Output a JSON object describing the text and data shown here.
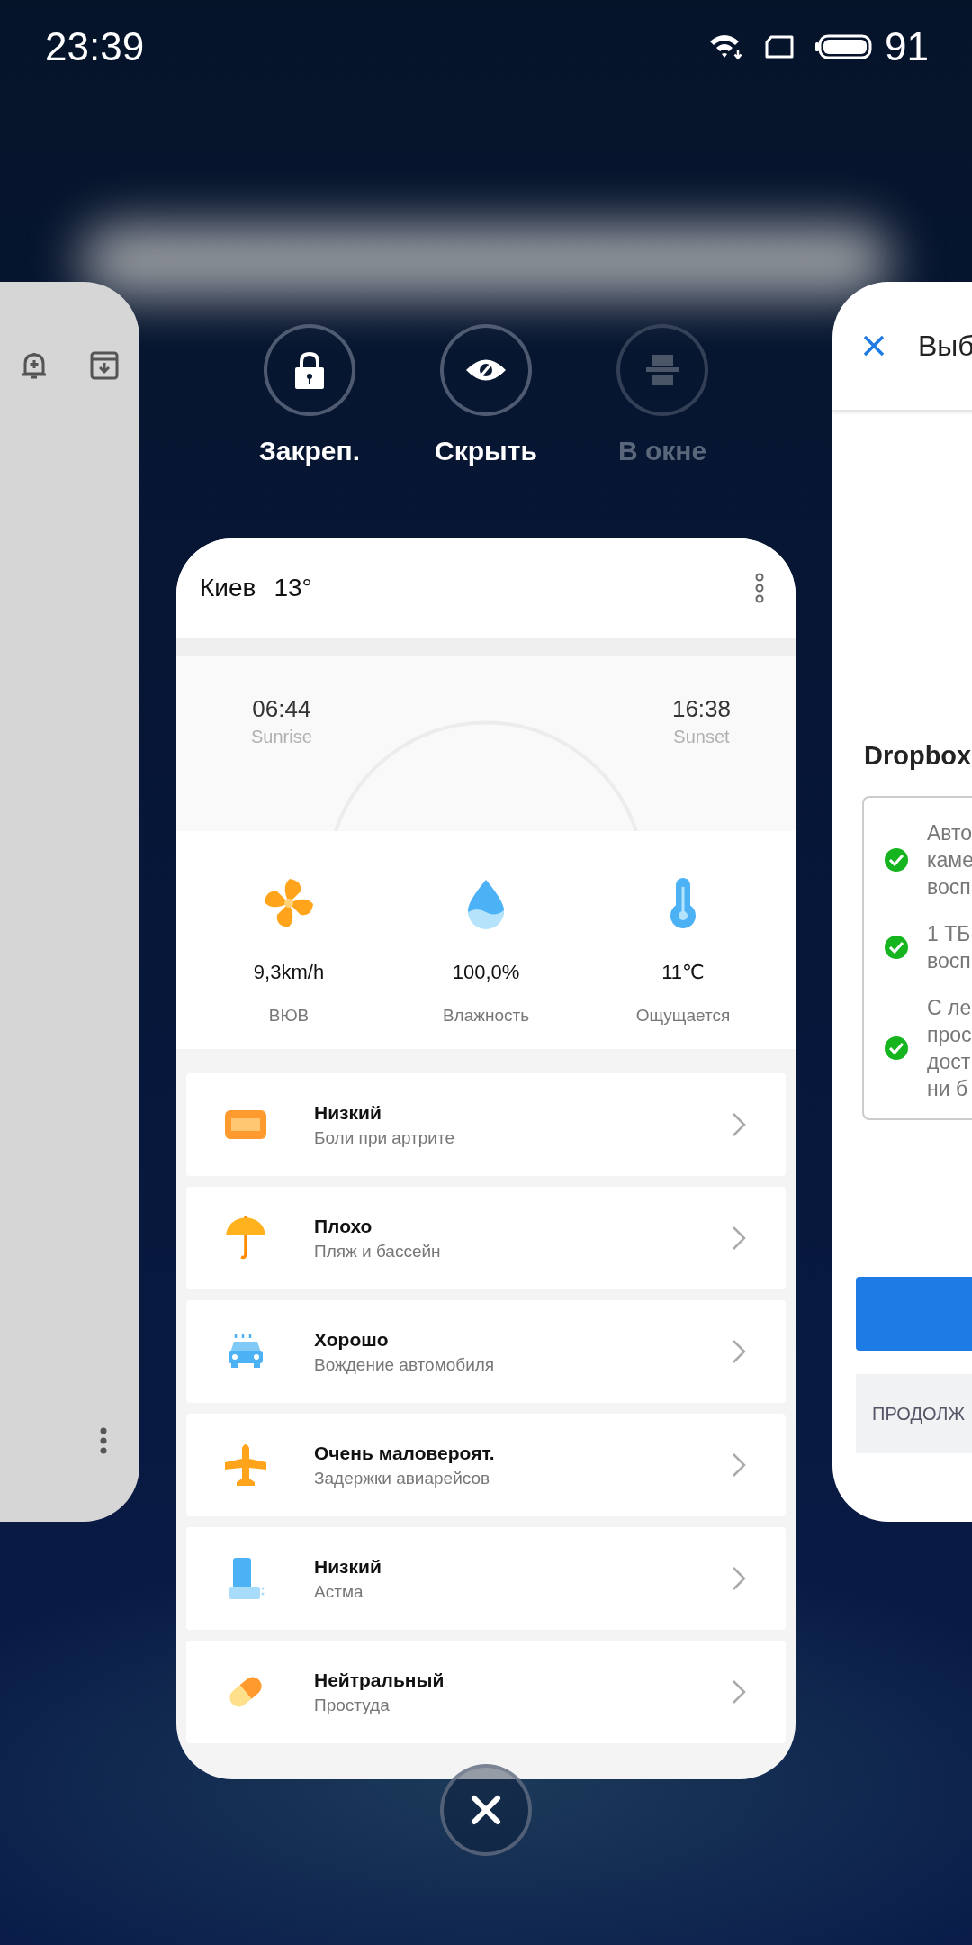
{
  "status_bar": {
    "time": "23:39",
    "battery": "91"
  },
  "actions": [
    {
      "kind": "lock",
      "label": "Закреп.",
      "disabled": false
    },
    {
      "kind": "eye",
      "label": "Скрыть",
      "disabled": false
    },
    {
      "kind": "window",
      "label": "В окне",
      "disabled": true
    }
  ],
  "weather_card": {
    "city": "Киев",
    "temperature": "13°",
    "sunrise": {
      "time": "06:44",
      "label": "Sunrise"
    },
    "sunset": {
      "time": "16:38",
      "label": "Sunset"
    },
    "stats": [
      {
        "kind": "wind",
        "value": "9,3km/h",
        "label": "ВЮВ"
      },
      {
        "kind": "humidity",
        "value": "100,0%",
        "label": "Влажность"
      },
      {
        "kind": "feels",
        "value": "11℃",
        "label": "Ощущается"
      }
    ],
    "indices": [
      {
        "kind": "arthritis",
        "level_text": "Низкий",
        "title": "Боли при артрите"
      },
      {
        "kind": "beach",
        "level_text": "Плохо",
        "title": "Пляж и бассейн"
      },
      {
        "kind": "driving",
        "level_text": "Хорошо",
        "title": "Вождение автомобиля"
      },
      {
        "kind": "flight",
        "level_text": "Очень маловероят.",
        "title": "Задержки авиарейсов"
      },
      {
        "kind": "asthma",
        "level_text": "Низкий",
        "title": "Астма"
      },
      {
        "kind": "cold",
        "level_text": "Нейтральный",
        "title": "Простуда"
      }
    ]
  },
  "dropbox_card": {
    "title": "Выб",
    "heading": "Dropbox",
    "benefits": [
      {
        "lines": [
          "Авто",
          "каме",
          "восп"
        ]
      },
      {
        "lines": [
          "1 ТБ",
          "восп"
        ]
      },
      {
        "lines": [
          "С ле",
          "прос",
          "дост",
          "ни б"
        ]
      }
    ],
    "secondary_button": "ПРОДОЛЖ"
  }
}
